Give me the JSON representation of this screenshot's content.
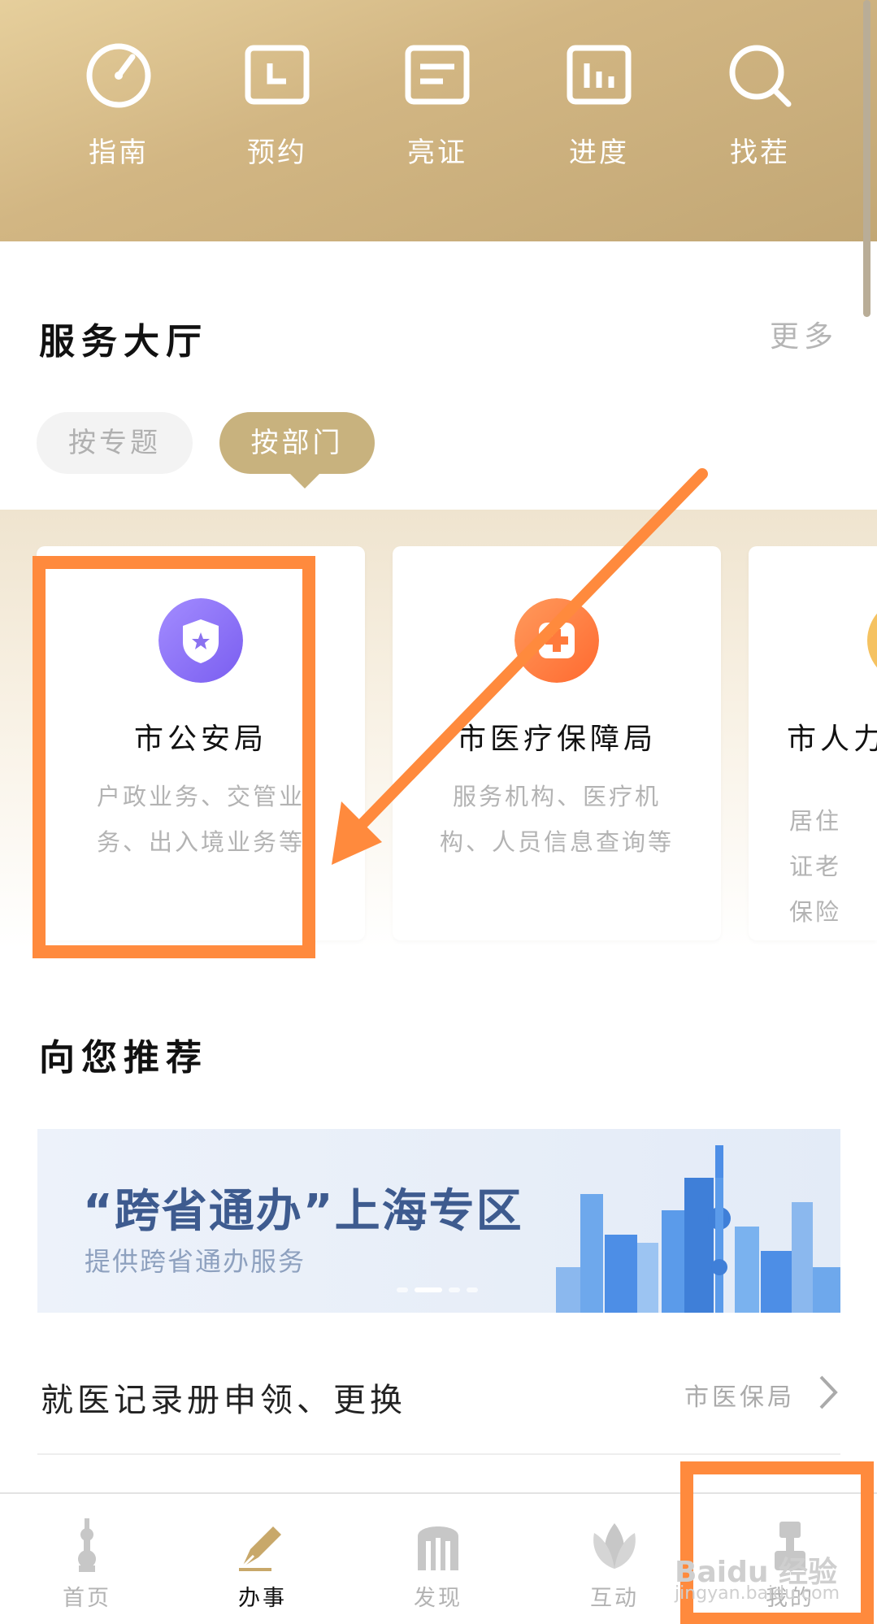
{
  "quickbar": {
    "items": [
      {
        "label": "指南",
        "icon": "gauge-icon"
      },
      {
        "label": "预约",
        "icon": "calendar-icon"
      },
      {
        "label": "亮证",
        "icon": "id-card-icon"
      },
      {
        "label": "进度",
        "icon": "progress-chart-icon"
      },
      {
        "label": "找茬",
        "icon": "search-icon"
      }
    ]
  },
  "service_hall": {
    "title": "服务大厅",
    "more": "更多",
    "filters": [
      {
        "label": "按专题",
        "active": false
      },
      {
        "label": "按部门",
        "active": true
      }
    ],
    "departments": [
      {
        "name": "市公安局",
        "desc": "户政业务、交管业务、出入境业务等",
        "icon": "police-shield-icon",
        "color": "#8a72f0"
      },
      {
        "name": "市医疗保障局",
        "desc": "服务机构、医疗机构、人员信息查询等",
        "icon": "medical-cross-icon",
        "color": "#ff7a3c"
      },
      {
        "name": "市人力",
        "desc": "居住证老保险",
        "icon": "hr-icon",
        "color": "#f5c261"
      }
    ]
  },
  "recommend": {
    "title": "向您推荐",
    "banner": {
      "title": "“跨省通办”上海专区",
      "subtitle": "提供跨省通办服务"
    },
    "items": [
      {
        "title": "就医记录册申领、更换",
        "dept": "市医保局"
      }
    ]
  },
  "tabbar": {
    "tabs": [
      {
        "label": "首页",
        "icon": "pearl-tower-icon",
        "active": false
      },
      {
        "label": "办事",
        "icon": "pen-icon",
        "active": true
      },
      {
        "label": "发现",
        "icon": "arch-building-icon",
        "active": false
      },
      {
        "label": "互动",
        "icon": "magnolia-icon",
        "active": false
      },
      {
        "label": "我的",
        "icon": "profile-icon",
        "active": false
      }
    ]
  },
  "watermark": {
    "brand": "Baidu 经验",
    "url": "jingyan.baidu.com"
  },
  "colors": {
    "gold": "#c8b27e",
    "annotation": "#ff8a3d"
  }
}
